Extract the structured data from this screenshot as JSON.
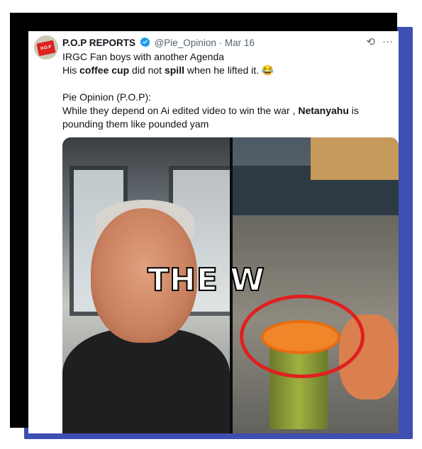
{
  "post": {
    "display_name": "P.O.P REPORTS",
    "handle": "@Pie_Opinion",
    "separator": "·",
    "date": "Mar 16",
    "more_label": "···",
    "grok_label": "⟲",
    "line1": "IRGC Fan boys with another Agenda",
    "line2_pre": "His ",
    "line2_bold1": "coffee cup",
    "line2_mid": " did not ",
    "line2_bold2": "spill",
    "line2_post": " when he lifted it. 😂",
    "line3": "Pie Opinion (P.O.P):",
    "line4_pre": "While they depend on Ai edited video to win the war , ",
    "line4_bold": "Netanyahu",
    "line4_post": " is pounding them like pounded yam"
  },
  "avatar_text": "P.O.P",
  "media": {
    "overlay_text": "THE W",
    "highlight_color": "#e0201e"
  },
  "colors": {
    "verified": "#1d9bf0",
    "frame_shadow": "#3d4fb0"
  }
}
